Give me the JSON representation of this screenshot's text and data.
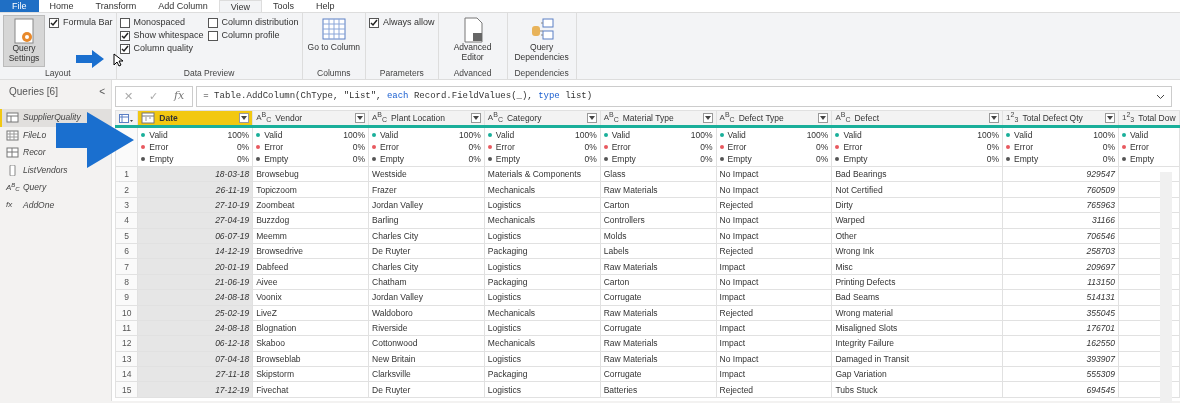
{
  "tabs": [
    {
      "label": "File",
      "kind": "file",
      "selected": false
    },
    {
      "label": "Home",
      "kind": "tab",
      "selected": false
    },
    {
      "label": "Transform",
      "kind": "tab",
      "selected": false
    },
    {
      "label": "Add Column",
      "kind": "tab",
      "selected": false
    },
    {
      "label": "View",
      "kind": "tab",
      "selected": true
    },
    {
      "label": "Tools",
      "kind": "tab",
      "selected": false
    },
    {
      "label": "Help",
      "kind": "tab",
      "selected": false
    }
  ],
  "ribbon": [
    {
      "group": "Layout",
      "items": [
        {
          "kind": "settings",
          "label": "Query Settings",
          "selected": true
        },
        {
          "kind": "checks",
          "checks": [
            {
              "label": "Formula Bar",
              "checked": true
            }
          ]
        }
      ]
    },
    {
      "group": "Data Preview",
      "items": [
        {
          "kind": "checks",
          "checks": [
            {
              "label": "Monospaced",
              "checked": false
            },
            {
              "label": "Show whitespace",
              "checked": true
            },
            {
              "label": "Column quality",
              "checked": true
            }
          ]
        },
        {
          "kind": "checks",
          "checks": [
            {
              "label": "Column distribution",
              "checked": false
            },
            {
              "label": "Column profile",
              "checked": false
            }
          ]
        }
      ]
    },
    {
      "group": "Columns",
      "items": [
        {
          "kind": "goto",
          "label": "Go to Column",
          "selected": false
        }
      ]
    },
    {
      "group": "Parameters",
      "items": [
        {
          "kind": "checks",
          "checks": [
            {
              "label": "Always allow",
              "checked": true
            }
          ]
        }
      ]
    },
    {
      "group": "Advanced",
      "items": [
        {
          "kind": "editor",
          "label": "Advanced Editor",
          "selected": false
        }
      ]
    },
    {
      "group": "Dependencies",
      "items": [
        {
          "kind": "deps",
          "label": "Query Dependencies",
          "selected": false
        }
      ]
    }
  ],
  "queries": {
    "title": "Queries [6]",
    "collapse": "<",
    "items": [
      {
        "name": "SupplierQuality",
        "kind": "table",
        "selected": true
      },
      {
        "name": "FileLo",
        "kind": "file",
        "selected": false
      },
      {
        "name": "Recor",
        "kind": "record",
        "selected": false
      },
      {
        "name": "ListVendors",
        "kind": "list",
        "selected": false
      },
      {
        "name": "Query",
        "kind": "label",
        "icon_label": "A$^{B}$$_{C}$",
        "selected": false
      },
      {
        "name": "AddOne",
        "kind": "label",
        "icon_label": "fx",
        "selected": false
      }
    ]
  },
  "formula_bar": {
    "buttons": [
      "✕",
      "✓",
      "fx"
    ],
    "tokens": [
      {
        "text": "= Table.AddColumn(ChType, \"List\", ",
        "kind": "plain"
      },
      {
        "text": "each",
        "kind": "keyword"
      },
      {
        "text": " Record.FieldValues(_), ",
        "kind": "plain"
      },
      {
        "text": "type",
        "kind": "keyword"
      },
      {
        "text": " list)",
        "kind": "plain"
      }
    ]
  },
  "table": {
    "columns": [
      {
        "name": "Date",
        "kind": "date",
        "selected": true,
        "quality": [
          {
            "label": "Valid",
            "value": "100%",
            "color": "#1aaf9a"
          },
          {
            "label": "Error",
            "value": "0%",
            "color": "#e8595f"
          },
          {
            "label": "Empty",
            "value": "0%",
            "color": "#555555"
          }
        ]
      },
      {
        "name": "Vendor",
        "kind": "text",
        "type_label": "A$^{B}$$_{C}$",
        "selected": false,
        "quality": [
          {
            "label": "Valid",
            "value": "100%",
            "color": "#1aaf9a"
          },
          {
            "label": "Error",
            "value": "0%",
            "color": "#e8595f"
          },
          {
            "label": "Empty",
            "value": "0%",
            "color": "#555555"
          }
        ]
      },
      {
        "name": "Plant Location",
        "kind": "text",
        "type_label": "A$^{B}$$_{C}$",
        "selected": false,
        "quality": [
          {
            "label": "Valid",
            "value": "100%",
            "color": "#1aaf9a"
          },
          {
            "label": "Error",
            "value": "0%",
            "color": "#e8595f"
          },
          {
            "label": "Empty",
            "value": "0%",
            "color": "#555555"
          }
        ]
      },
      {
        "name": "Category",
        "kind": "text",
        "type_label": "A$^{B}$$_{C}$",
        "selected": false,
        "quality": [
          {
            "label": "Valid",
            "value": "100%",
            "color": "#1aaf9a"
          },
          {
            "label": "Error",
            "value": "0%",
            "color": "#e8595f"
          },
          {
            "label": "Empty",
            "value": "0%",
            "color": "#555555"
          }
        ]
      },
      {
        "name": "Material Type",
        "kind": "text",
        "type_label": "A$^{B}$$_{C}$",
        "selected": false,
        "quality": [
          {
            "label": "Valid",
            "value": "100%",
            "color": "#1aaf9a"
          },
          {
            "label": "Error",
            "value": "0%",
            "color": "#e8595f"
          },
          {
            "label": "Empty",
            "value": "0%",
            "color": "#555555"
          }
        ]
      },
      {
        "name": "Defect Type",
        "kind": "text",
        "type_label": "A$^{B}$$_{C}$",
        "selected": false,
        "quality": [
          {
            "label": "Valid",
            "value": "100%",
            "color": "#1aaf9a"
          },
          {
            "label": "Error",
            "value": "0%",
            "color": "#e8595f"
          },
          {
            "label": "Empty",
            "value": "0%",
            "color": "#555555"
          }
        ]
      },
      {
        "name": "Defect",
        "kind": "text",
        "type_label": "A$^{B}$$_{C}$",
        "selected": false,
        "quality": [
          {
            "label": "Valid",
            "value": "100%",
            "color": "#1aaf9a"
          },
          {
            "label": "Error",
            "value": "0%",
            "color": "#e8595f"
          },
          {
            "label": "Empty",
            "value": "0%",
            "color": "#555555"
          }
        ]
      },
      {
        "name": "Total Defect Qty",
        "kind": "number",
        "type_label": "1$^{2}$$_{3}$",
        "selected": false,
        "quality": [
          {
            "label": "Valid",
            "value": "100%",
            "color": "#1aaf9a"
          },
          {
            "label": "Error",
            "value": "0%",
            "color": "#e8595f"
          },
          {
            "label": "Empty",
            "value": "0%",
            "color": "#555555"
          }
        ]
      },
      {
        "name": "Total Dow",
        "kind": "number",
        "type_label": "1$^{2}$$_{3}$",
        "selected": false,
        "quality": [
          {
            "label": "Valid",
            "color": "#1aaf9a"
          },
          {
            "label": "Error",
            "color": "#e8595f"
          },
          {
            "label": "Empty",
            "color": "#555555"
          }
        ]
      }
    ],
    "rows": [
      {
        "index": "1",
        "cells": [
          "18-03-18",
          "Browsebug",
          "Westside",
          "Materials & Components",
          "Glass",
          "No Impact",
          "Bad Bearings",
          "929547"
        ]
      },
      {
        "index": "2",
        "cells": [
          "26-11-19",
          "Topiczoom",
          "Frazer",
          "Mechanicals",
          "Raw Materials",
          "No Impact",
          "Not Certified",
          "760509"
        ]
      },
      {
        "index": "3",
        "cells": [
          "27-10-19",
          "Zoombeat",
          "Jordan Valley",
          "Logistics",
          "Carton",
          "Rejected",
          "Dirty",
          "765963"
        ]
      },
      {
        "index": "4",
        "cells": [
          "27-04-19",
          "Buzzdog",
          "Barling",
          "Mechanicals",
          "Controllers",
          "No Impact",
          "Warped",
          "31166"
        ]
      },
      {
        "index": "5",
        "cells": [
          "06-07-19",
          "Meemm",
          "Charles City",
          "Logistics",
          "Molds",
          "No Impact",
          "Other",
          "706546"
        ]
      },
      {
        "index": "6",
        "cells": [
          "14-12-19",
          "Browsedrive",
          "De Ruyter",
          "Packaging",
          "Labels",
          "Rejected",
          "Wrong Ink",
          "258703"
        ]
      },
      {
        "index": "7",
        "cells": [
          "20-01-19",
          "Dabfeed",
          "Charles City",
          "Logistics",
          "Raw Materials",
          "Impact",
          "Misc",
          "209697"
        ]
      },
      {
        "index": "8",
        "cells": [
          "21-06-19",
          "Aivee",
          "Chatham",
          "Packaging",
          "Carton",
          "No Impact",
          "Printing Defects",
          "113150"
        ]
      },
      {
        "index": "9",
        "cells": [
          "24-08-18",
          "Voonix",
          "Jordan Valley",
          "Logistics",
          "Corrugate",
          "Impact",
          "Bad Seams",
          "514131"
        ]
      },
      {
        "index": "10",
        "cells": [
          "25-02-19",
          "LiveZ",
          "Waldoboro",
          "Mechanicals",
          "Raw Materials",
          "Rejected",
          "Wrong material",
          "355045"
        ]
      },
      {
        "index": "11",
        "cells": [
          "24-08-18",
          "Blognation",
          "Riverside",
          "Logistics",
          "Corrugate",
          "Impact",
          "Misaligned Slots",
          "176701"
        ]
      },
      {
        "index": "12",
        "cells": [
          "06-12-18",
          "Skaboo",
          "Cottonwood",
          "Mechanicals",
          "Raw Materials",
          "Impact",
          "Integrity Failure",
          "162550"
        ]
      },
      {
        "index": "13",
        "cells": [
          "07-04-18",
          "Browseblab",
          "New Britain",
          "Logistics",
          "Raw Materials",
          "No Impact",
          "Damaged in Transit",
          "393907"
        ]
      },
      {
        "index": "14",
        "cells": [
          "27-11-18",
          "Skipstorm",
          "Clarksville",
          "Packaging",
          "Corrugate",
          "Impact",
          "Gap Variation",
          "555309"
        ]
      },
      {
        "index": "15",
        "cells": [
          "17-12-19",
          "Fivechat",
          "De Ruyter",
          "Logistics",
          "Batteries",
          "Rejected",
          "Tubs Stuck",
          "694545"
        ]
      }
    ]
  }
}
